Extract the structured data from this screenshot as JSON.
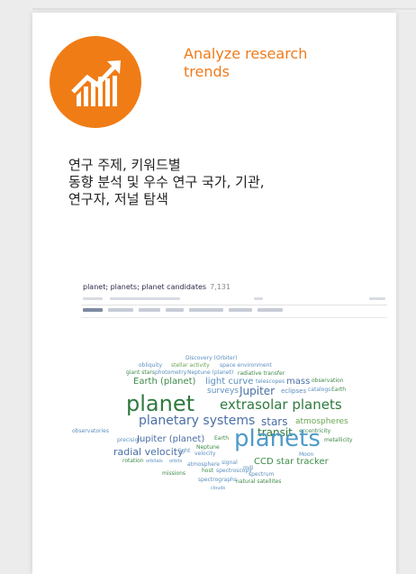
{
  "feature": {
    "title_line1": "Analyze research",
    "title_line2": "trends",
    "icon": "trend-chart-icon",
    "accent_color": "#f07c16"
  },
  "description": {
    "line1": "연구 주제, 키워드별",
    "line2": "동향 분석 및 우수 연구 국가, 기관,",
    "line3": "연구자, 저널 탐색"
  },
  "screenshot": {
    "query": "planet; planets; planet candidates",
    "count": "7,131"
  },
  "word_cloud": {
    "words": [
      {
        "text": "Discovery (Orbiter)",
        "cls": "c1"
      },
      {
        "text": "obliquity",
        "cls": "c1"
      },
      {
        "text": "stellar activity",
        "cls": "c5"
      },
      {
        "text": "space environment",
        "cls": "c1"
      },
      {
        "text": "giant stars",
        "cls": "c2"
      },
      {
        "text": "photometry",
        "cls": "c1"
      },
      {
        "text": "Neptune (planet)",
        "cls": "c1"
      },
      {
        "text": "radiative transfer",
        "cls": "c2"
      },
      {
        "text": "Earth (planet)",
        "cls": "c2"
      },
      {
        "text": "light curve",
        "cls": "c1"
      },
      {
        "text": "telescopes",
        "cls": "c1"
      },
      {
        "text": "mass",
        "cls": "c4"
      },
      {
        "text": "observation",
        "cls": "c2"
      },
      {
        "text": "surveys",
        "cls": "c1"
      },
      {
        "text": "Jupiter",
        "cls": "c4"
      },
      {
        "text": "eclipses",
        "cls": "c1"
      },
      {
        "text": "catalogs",
        "cls": "c1"
      },
      {
        "text": "Earth",
        "cls": "c2"
      },
      {
        "text": "planet",
        "cls": "c3"
      },
      {
        "text": "extrasolar planets",
        "cls": "c3"
      },
      {
        "text": "planetary systems",
        "cls": "c4"
      },
      {
        "text": "stars",
        "cls": "c4"
      },
      {
        "text": "atmospheres",
        "cls": "c5"
      },
      {
        "text": "observatories",
        "cls": "c1"
      },
      {
        "text": "transit",
        "cls": "c3"
      },
      {
        "text": "eccentricity",
        "cls": "c2"
      },
      {
        "text": "precision",
        "cls": "c1"
      },
      {
        "text": "Jupiter (planet)",
        "cls": "c4"
      },
      {
        "text": "Earth",
        "cls": "c2"
      },
      {
        "text": "planets",
        "cls": "c6"
      },
      {
        "text": "metallicity",
        "cls": "c2"
      },
      {
        "text": "radial velocity",
        "cls": "c4"
      },
      {
        "text": "light",
        "cls": "c1"
      },
      {
        "text": "Neptune",
        "cls": "c2"
      },
      {
        "text": "velocity",
        "cls": "c1"
      },
      {
        "text": "Moon",
        "cls": "c1"
      },
      {
        "text": "rotation",
        "cls": "c2"
      },
      {
        "text": "orbitals",
        "cls": "c1"
      },
      {
        "text": "orbits",
        "cls": "c1"
      },
      {
        "text": "atmosphere",
        "cls": "c1"
      },
      {
        "text": "signal",
        "cls": "c1"
      },
      {
        "text": "CCD star tracker",
        "cls": "c2"
      },
      {
        "text": "host",
        "cls": "c2"
      },
      {
        "text": "spectroscopy",
        "cls": "c1"
      },
      {
        "text": "mdi",
        "cls": "c1"
      },
      {
        "text": "missions",
        "cls": "c2"
      },
      {
        "text": "spectrum",
        "cls": "c1"
      },
      {
        "text": "spectrographs",
        "cls": "c1"
      },
      {
        "text": "natural satellites",
        "cls": "c2"
      },
      {
        "text": "clouds",
        "cls": "c1"
      }
    ]
  }
}
